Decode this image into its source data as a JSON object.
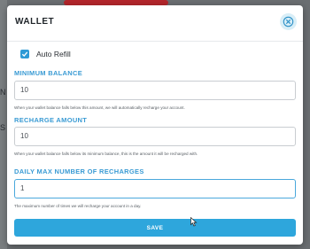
{
  "background": {
    "fragments": [
      "N",
      "S"
    ]
  },
  "modal": {
    "title": "WALLET",
    "auto_refill": {
      "label": "Auto Refill",
      "checked": true
    },
    "minimum_balance": {
      "label": "MINIMUM BALANCE",
      "value": "10",
      "help": "When your wallet balance falls below this amount, we will automatically recharge your account."
    },
    "recharge_amount": {
      "label": "RECHARGE AMOUNT",
      "value": "10",
      "help": "When your wallet balance falls below its minimum balance, this is the amount it will be recharged with."
    },
    "daily_max": {
      "label": "DAILY MAX NUMBER OF RECHARGES",
      "value": "1",
      "help": "The maximum number of times we will recharge your account in a day."
    },
    "save_label": "SAVE"
  },
  "colors": {
    "accent": "#2ea6dc",
    "label": "#3a9bd4",
    "overlay": "#5f6366"
  },
  "icons": [
    "close-icon",
    "check-icon",
    "mouse-cursor-icon"
  ]
}
